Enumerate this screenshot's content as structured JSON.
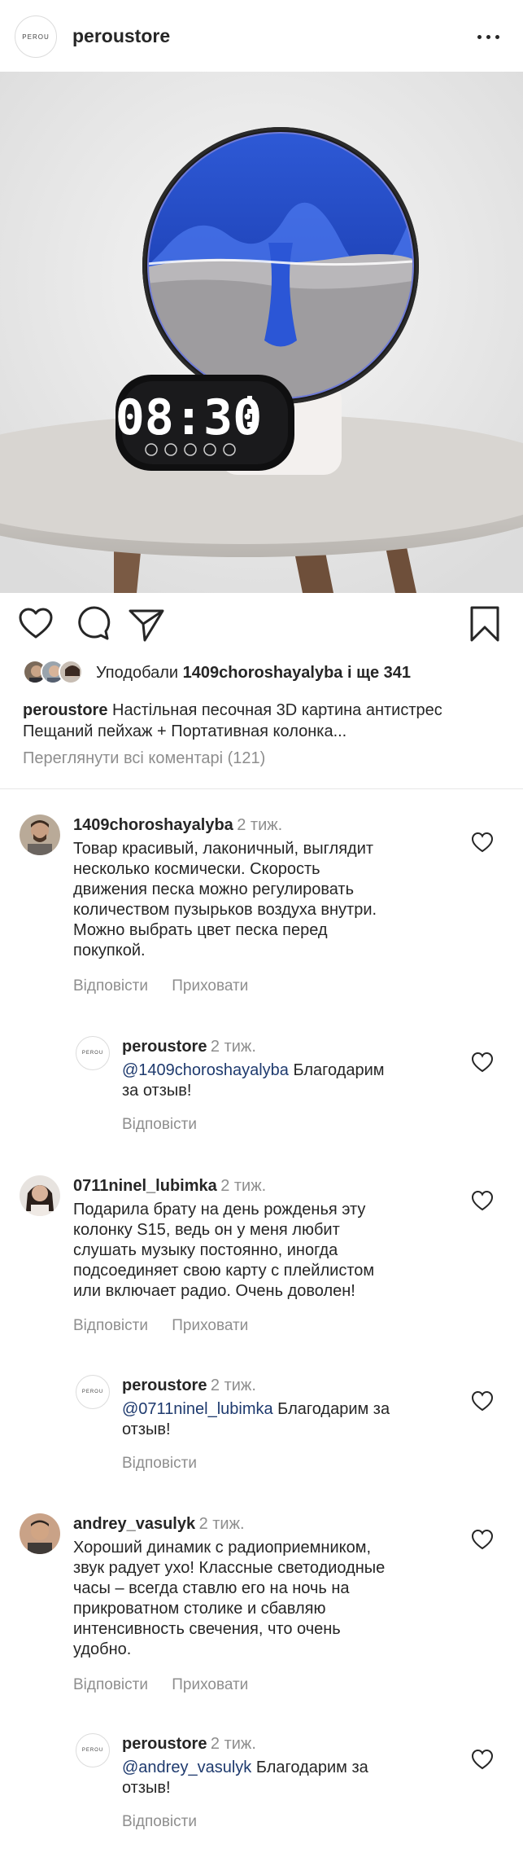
{
  "header": {
    "brand_logo_text": "PEROU",
    "username": "peroustore"
  },
  "post": {
    "likes": {
      "prefix": "Уподобали",
      "user": "1409choroshayalyba",
      "suffix": "і ще 341"
    },
    "caption": {
      "user": "peroustore",
      "text": "Настільная песочная 3D картина антистрес Пещаний пейхаж + Портативная колонка..."
    },
    "view_all_comments": "Переглянути всі коментарі (121)"
  },
  "clock_display": "08:30",
  "comments": [
    {
      "user": "1409choroshayalyba",
      "time": "2 тиж.",
      "lines": [
        "Товар красивый, лаконичный, выглядит",
        "несколько космически. Скорость",
        "движения песка можно регулировать",
        "количеством пузырьков воздуха внутри.",
        "Можно выбрать цвет песка перед",
        "покупкой."
      ],
      "reply_label": "Відповісти",
      "hide_label": "Приховати",
      "reply": {
        "user": "peroustore",
        "time": "2 тиж.",
        "mention": "@1409choroshayalyba",
        "line1_rest": "Благодарим",
        "line2": "за отзыв!",
        "reply_label": "Відповісти"
      }
    },
    {
      "user": "0711ninel_lubimka",
      "time": "2 тиж.",
      "lines": [
        "Подарила брату на день рожденья эту",
        "колонку S15, ведь он у меня любит",
        "слушать музыку постоянно, иногда",
        "подсоединяет свою карту с плейлистом",
        "или включает радио. Очень доволен!"
      ],
      "reply_label": "Відповісти",
      "hide_label": "Приховати",
      "reply": {
        "user": "peroustore",
        "time": "2 тиж.",
        "mention": "@0711ninel_lubimka",
        "line1_rest": "Благодарим за",
        "line2": "отзыв!",
        "reply_label": "Відповісти"
      }
    },
    {
      "user": "andrey_vasulyk",
      "time": "2 тиж.",
      "lines": [
        "Хороший динамик с радиоприемником,",
        "звук радует ухо! Классные светодиодные",
        "часы – всегда ставлю его на ночь на",
        "прикроватном столике и сбавляю",
        "интенсивность свечения, что очень",
        "удобно."
      ],
      "reply_label": "Відповісти",
      "hide_label": "Приховати",
      "reply": {
        "user": "peroustore",
        "time": "2 тиж.",
        "mention": "@andrey_vasulyk",
        "line1_rest": "Благодарим за",
        "line2": "отзыв!",
        "reply_label": "Відповісти"
      }
    }
  ]
}
